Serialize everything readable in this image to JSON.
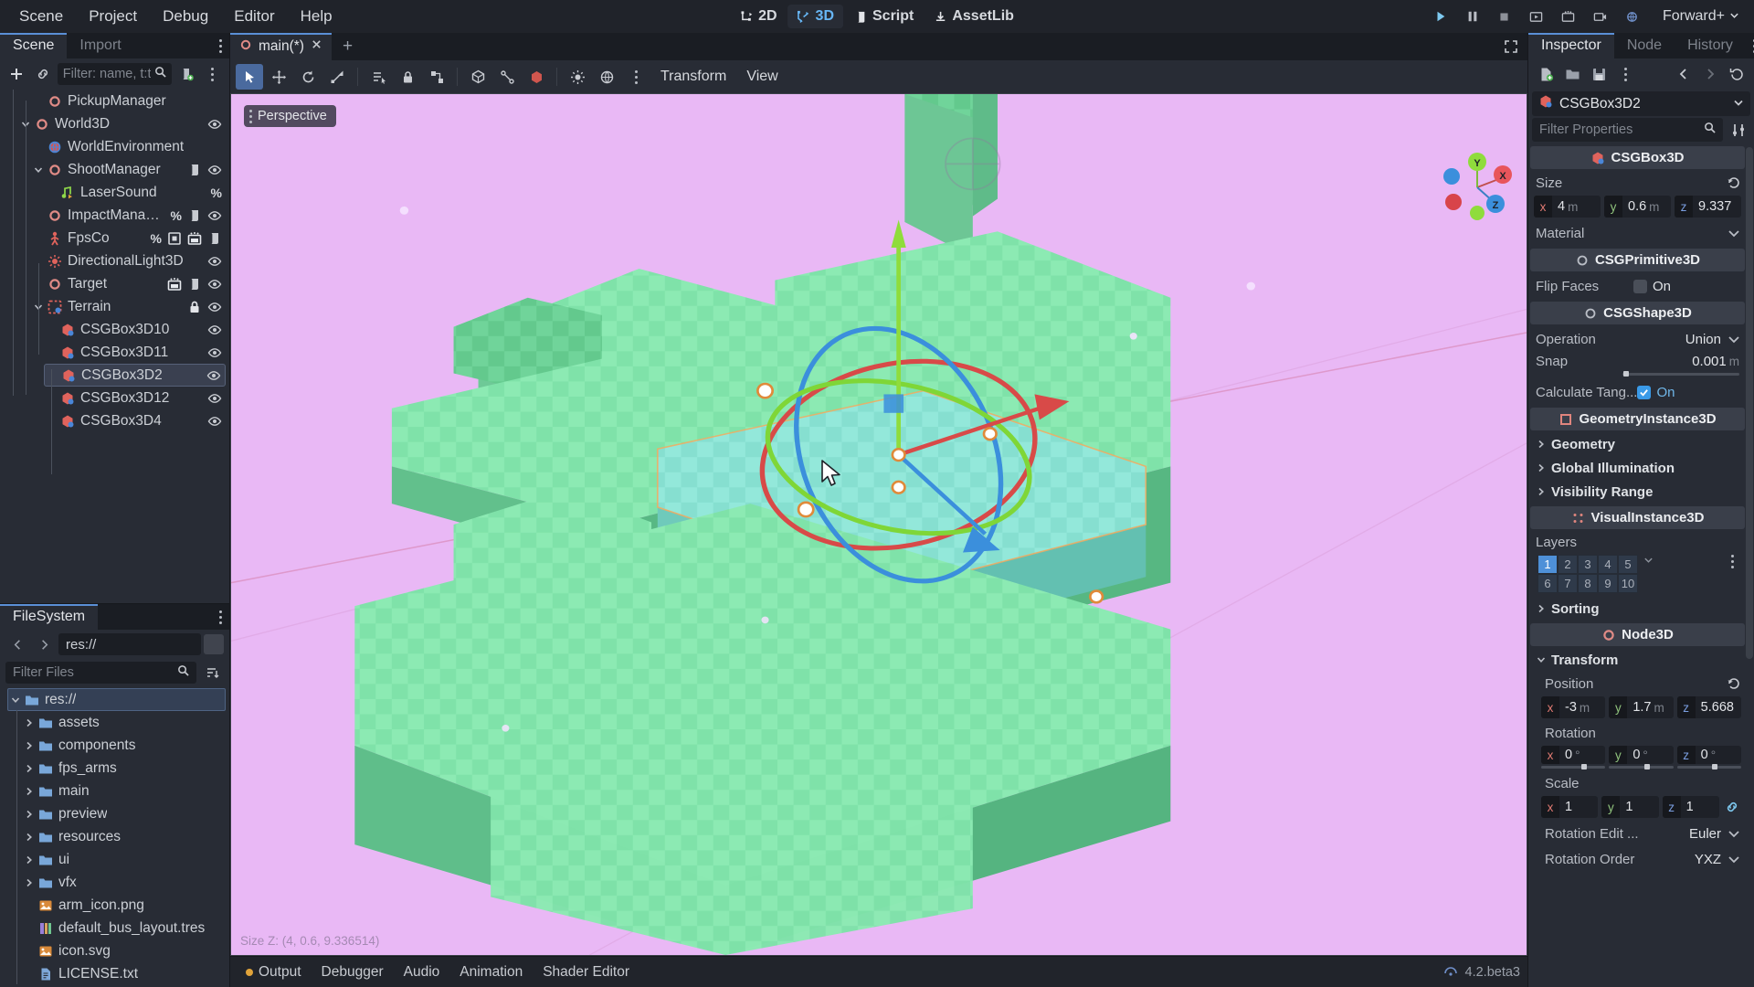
{
  "menubar": {
    "items": [
      "Scene",
      "Project",
      "Debug",
      "Editor",
      "Help"
    ],
    "modes": [
      {
        "label": "2D",
        "icon": "2d-icon",
        "active": false
      },
      {
        "label": "3D",
        "icon": "3d-icon",
        "active": true
      },
      {
        "label": "Script",
        "icon": "script-icon",
        "active": false
      },
      {
        "label": "AssetLib",
        "icon": "assetlib-icon",
        "active": false
      }
    ],
    "renderer": "Forward+",
    "play_buttons": [
      "play-icon",
      "pause-icon",
      "stop-icon",
      "play-scene-icon",
      "play-custom-icon",
      "movie-icon",
      "remote-debug-icon"
    ]
  },
  "scene_dock": {
    "tabs": [
      {
        "label": "Scene",
        "active": true
      },
      {
        "label": "Import",
        "active": false
      }
    ],
    "toolbar": {
      "add_label": "+",
      "filter_placeholder": "Filter: name, t:ty"
    },
    "tree": [
      {
        "name": "PickupManager",
        "depth": 2,
        "icon": "node-icon",
        "expander": "",
        "badges": [],
        "eye": false,
        "selected": false
      },
      {
        "name": "World3D",
        "depth": 1,
        "icon": "node3d-icon",
        "expander": "down",
        "badges": [],
        "eye": true,
        "selected": false
      },
      {
        "name": "WorldEnvironment",
        "depth": 2,
        "icon": "worldenvironment-icon",
        "expander": "",
        "badges": [],
        "eye": false,
        "selected": false
      },
      {
        "name": "ShootManager",
        "depth": 2,
        "icon": "node3d-icon",
        "expander": "down",
        "badges": [
          "script-icon"
        ],
        "eye": true,
        "selected": false
      },
      {
        "name": "LaserSound",
        "depth": 3,
        "icon": "audiostream-icon",
        "expander": "",
        "badges": [
          "pct"
        ],
        "eye": false,
        "selected": false
      },
      {
        "name": "ImpactManager",
        "depth": 2,
        "icon": "node3d-icon",
        "expander": "",
        "badges": [
          "pct",
          "script-icon"
        ],
        "eye": true,
        "selected": false
      },
      {
        "name": "FpsCo",
        "depth": 2,
        "icon": "character-icon",
        "expander": "",
        "badges": [
          "pct",
          "signal-icon",
          "anim-icon",
          "script-icon"
        ],
        "eye": false,
        "selected": false
      },
      {
        "name": "DirectionalLight3D",
        "depth": 2,
        "icon": "light-icon",
        "expander": "",
        "badges": [],
        "eye": true,
        "selected": false
      },
      {
        "name": "Target",
        "depth": 2,
        "icon": "node3d-icon",
        "expander": "",
        "badges": [
          "anim-icon",
          "script-icon"
        ],
        "eye": true,
        "selected": false
      },
      {
        "name": "Terrain",
        "depth": 2,
        "icon": "terrain-icon",
        "expander": "down",
        "badges": [
          "lock-icon"
        ],
        "eye": true,
        "selected": false
      },
      {
        "name": "CSGBox3D10",
        "depth": 3,
        "icon": "csgbox-icon",
        "expander": "",
        "badges": [],
        "eye": true,
        "selected": false
      },
      {
        "name": "CSGBox3D11",
        "depth": 3,
        "icon": "csgbox-icon",
        "expander": "",
        "badges": [],
        "eye": true,
        "selected": false
      },
      {
        "name": "CSGBox3D2",
        "depth": 3,
        "icon": "csgbox-icon",
        "expander": "",
        "badges": [],
        "eye": true,
        "selected": true
      },
      {
        "name": "CSGBox3D12",
        "depth": 3,
        "icon": "csgbox-icon",
        "expander": "",
        "badges": [],
        "eye": true,
        "selected": false
      },
      {
        "name": "CSGBox3D4",
        "depth": 3,
        "icon": "csgbox-icon",
        "expander": "",
        "badges": [],
        "eye": true,
        "selected": false
      }
    ]
  },
  "filesystem": {
    "tab": "FileSystem",
    "path": "res://",
    "filter_placeholder": "Filter Files",
    "items": [
      {
        "name": "res://",
        "depth": 0,
        "type": "folder",
        "expander": "down",
        "selected": true
      },
      {
        "name": "assets",
        "depth": 1,
        "type": "folder",
        "expander": "right",
        "selected": false
      },
      {
        "name": "components",
        "depth": 1,
        "type": "folder",
        "expander": "right",
        "selected": false
      },
      {
        "name": "fps_arms",
        "depth": 1,
        "type": "folder",
        "expander": "right",
        "selected": false
      },
      {
        "name": "main",
        "depth": 1,
        "type": "folder",
        "expander": "right",
        "selected": false
      },
      {
        "name": "preview",
        "depth": 1,
        "type": "folder",
        "expander": "right",
        "selected": false
      },
      {
        "name": "resources",
        "depth": 1,
        "type": "folder",
        "expander": "right",
        "selected": false
      },
      {
        "name": "ui",
        "depth": 1,
        "type": "folder",
        "expander": "right",
        "selected": false
      },
      {
        "name": "vfx",
        "depth": 1,
        "type": "folder",
        "expander": "right",
        "selected": false
      },
      {
        "name": "arm_icon.png",
        "depth": 1,
        "type": "image",
        "expander": "",
        "selected": false
      },
      {
        "name": "default_bus_layout.tres",
        "depth": 1,
        "type": "resource",
        "expander": "",
        "selected": false
      },
      {
        "name": "icon.svg",
        "depth": 1,
        "type": "image",
        "expander": "",
        "selected": false
      },
      {
        "name": "LICENSE.txt",
        "depth": 1,
        "type": "text",
        "expander": "",
        "selected": false
      }
    ]
  },
  "scene_tabs": {
    "tabs": [
      {
        "label": "main(*)",
        "active": true,
        "closable": true
      }
    ],
    "add_label": "+"
  },
  "viewport_toolbar": {
    "tools": [
      "select-tool-icon",
      "move-tool-icon",
      "rotate-tool-icon",
      "scale-tool-icon",
      "list-select-icon",
      "lock-icon",
      "group-icon",
      "mode-icon",
      "snap-icon",
      "gizmo-icon",
      "sun-icon",
      "environment-icon",
      "more-icon"
    ],
    "menus": [
      "Transform",
      "View"
    ]
  },
  "viewport": {
    "perspective_label": "Perspective",
    "status_text": "Size Z: (4, 0.6, 9.336514)",
    "gizmo_axes": [
      "X",
      "Y",
      "Z"
    ],
    "background_color": "#e9b8f5",
    "mesh_color": "#7ee0a8",
    "selected_color": "#8ce0d8"
  },
  "bottom_panel": {
    "tabs": [
      "Output",
      "Debugger",
      "Audio",
      "Animation",
      "Shader Editor"
    ],
    "version": "4.2.beta3"
  },
  "inspector": {
    "tabs": [
      {
        "label": "Inspector",
        "active": true
      },
      {
        "label": "Node",
        "active": false
      },
      {
        "label": "History",
        "active": false
      }
    ],
    "toolbar_icons": [
      "new-resource-icon",
      "open-resource-icon",
      "save-resource-icon",
      "more-icon",
      "back-icon",
      "forward-icon",
      "history-icon"
    ],
    "selected_object": "CSGBox3D2",
    "filter_placeholder": "Filter Properties",
    "sections": [
      {
        "type": "category",
        "title": "CSGBox3D",
        "icon": "csgbox-icon"
      },
      {
        "type": "vec3",
        "label": "Size",
        "axes": [
          {
            "axis": "x",
            "value": "4",
            "unit": "m"
          },
          {
            "axis": "y",
            "value": "0.6",
            "unit": "m"
          },
          {
            "axis": "z",
            "value": "9.337",
            "unit": ""
          }
        ],
        "reset": true
      },
      {
        "type": "combo",
        "label": "Material",
        "value": "<empty>"
      },
      {
        "type": "category",
        "title": "CSGPrimitive3D",
        "icon": "circle-icon"
      },
      {
        "type": "checkbox",
        "label": "Flip Faces",
        "value": "On",
        "checked": false
      },
      {
        "type": "category",
        "title": "CSGShape3D",
        "icon": "circle-icon"
      },
      {
        "type": "combo",
        "label": "Operation",
        "value": "Union"
      },
      {
        "type": "slider",
        "label": "Snap",
        "value": "0.001",
        "unit": "m",
        "pos": 1
      },
      {
        "type": "checkbox",
        "label": "Calculate Tang...",
        "value": "On",
        "checked": true
      },
      {
        "type": "category",
        "title": "GeometryInstance3D",
        "icon": "geometry-icon"
      },
      {
        "type": "fold",
        "label": "Geometry"
      },
      {
        "type": "fold",
        "label": "Global Illumination"
      },
      {
        "type": "fold",
        "label": "Visibility Range"
      },
      {
        "type": "category",
        "title": "VisualInstance3D",
        "icon": "visualinstance-icon"
      },
      {
        "type": "layers",
        "label": "Layers",
        "cells": [
          "1",
          "2",
          "3",
          "4",
          "5",
          "6",
          "7",
          "8",
          "9",
          "10"
        ],
        "on": [
          "1"
        ]
      },
      {
        "type": "fold",
        "label": "Sorting"
      },
      {
        "type": "category",
        "title": "Node3D",
        "icon": "node3d-icon"
      },
      {
        "type": "fold-open",
        "label": "Transform"
      },
      {
        "type": "vec3",
        "label": "Position",
        "indent": true,
        "axes": [
          {
            "axis": "x",
            "value": "-3",
            "unit": "m"
          },
          {
            "axis": "y",
            "value": "1.7",
            "unit": "m"
          },
          {
            "axis": "z",
            "value": "5.668",
            "unit": ""
          }
        ],
        "reset": true
      },
      {
        "type": "vec3-slider",
        "label": "Rotation",
        "indent": true,
        "axes": [
          {
            "axis": "x",
            "value": "0",
            "unit": "°"
          },
          {
            "axis": "y",
            "value": "0",
            "unit": "°"
          },
          {
            "axis": "z",
            "value": "0",
            "unit": "°"
          }
        ]
      },
      {
        "type": "vec3",
        "label": "Scale",
        "indent": true,
        "link": true,
        "axes": [
          {
            "axis": "x",
            "value": "1",
            "unit": ""
          },
          {
            "axis": "y",
            "value": "1",
            "unit": ""
          },
          {
            "axis": "z",
            "value": "1",
            "unit": ""
          }
        ]
      },
      {
        "type": "combo",
        "label": "Rotation Edit ...",
        "value": "Euler",
        "indent": true
      },
      {
        "type": "combo",
        "label": "Rotation Order",
        "value": "YXZ",
        "indent": true
      }
    ]
  },
  "colors": {
    "accent": "#5a8fd6",
    "panel_bg": "#282c35",
    "dark_bg": "#21242b",
    "field_bg": "#1e2128",
    "axis_x": "#e07a72",
    "axis_y": "#8fc27c",
    "axis_z": "#7a9ee0",
    "viewport_bg": "#e9b8f5"
  }
}
